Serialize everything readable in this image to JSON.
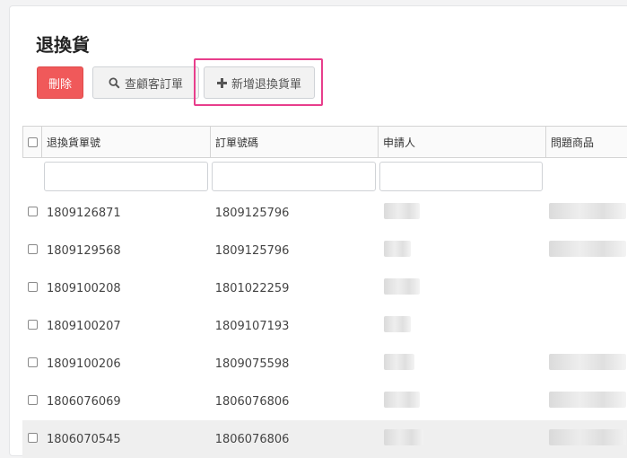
{
  "page": {
    "title": "退換貨"
  },
  "toolbar": {
    "delete_label": "刪除",
    "search_label": "查顧客訂單",
    "add_label": "新增退換貨單",
    "colors": {
      "danger": "#f0595a",
      "highlight": "#e83e8c"
    }
  },
  "table": {
    "headers": [
      "退換貨單號",
      "訂單號碼",
      "申請人",
      "問題商品"
    ],
    "rows": [
      {
        "return_no": "1809126871",
        "order_no": "1809125796"
      },
      {
        "return_no": "1809129568",
        "order_no": "1809125796"
      },
      {
        "return_no": "1809100208",
        "order_no": "1801022259"
      },
      {
        "return_no": "1809100207",
        "order_no": "1809107193"
      },
      {
        "return_no": "1809100206",
        "order_no": "1809075598"
      },
      {
        "return_no": "1806076069",
        "order_no": "1806076806"
      },
      {
        "return_no": "1806070545",
        "order_no": "1806076806"
      }
    ]
  }
}
